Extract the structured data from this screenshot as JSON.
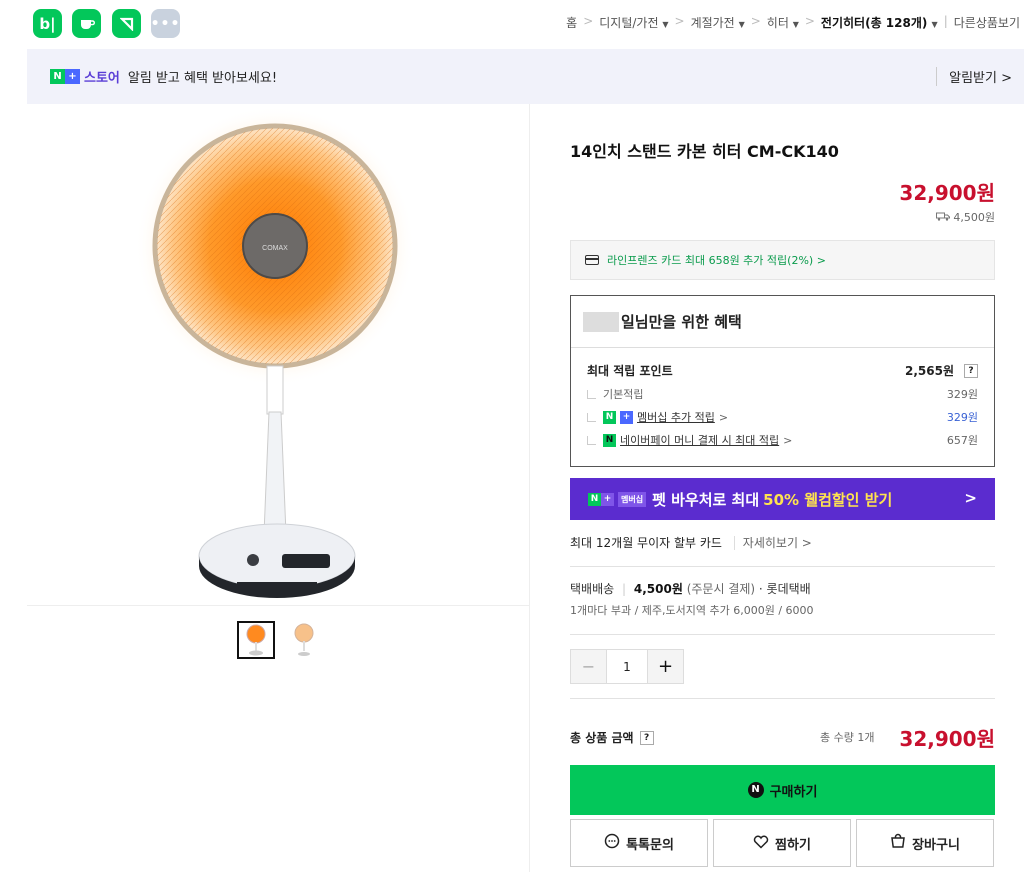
{
  "apps": [
    "blog",
    "cafe",
    "pay",
    "more"
  ],
  "breadcrumb": {
    "items": [
      "홈",
      "디지털/가전",
      "계절가전",
      "히터"
    ],
    "current": "전기히터(총 128개)",
    "other": "다른상품보기"
  },
  "banner": {
    "store_label": "스토어",
    "text": "알림 받고 혜택 받아보세요!",
    "action": "알림받기"
  },
  "product": {
    "title": "14인치 스탠드 카본 히터 CM-CK140",
    "price": "32,900원",
    "shipping_fee": "4,500원",
    "card_promo": "라인프렌즈 카드 최대 658원 추가 적립(2%) >",
    "brand_badge": "COMAX"
  },
  "benefit": {
    "header": "일님만을 위한 혜택",
    "max_label": "최대 적립 포인트",
    "max_value": "2,565원",
    "rows": [
      {
        "label": "기본적립",
        "value": "329원"
      },
      {
        "label": "멤버십 추가 적립",
        "value": "329원"
      },
      {
        "label": "네이버페이 머니 결제 시 최대 적립",
        "value": "657원"
      }
    ]
  },
  "promo": {
    "badge": "멤버십",
    "text_pre": "펫 바우처로 최대",
    "text_highlight": "50% 웰컴할인 받기",
    "chevron": ">"
  },
  "installment": {
    "text": "최대 12개월 무이자 할부 카드",
    "more": "자세히보기 >"
  },
  "delivery": {
    "method": "택배배송",
    "fee": "4,500원",
    "fee_note": "(주문시 결제)",
    "courier": "롯데택배",
    "extra": "1개마다 부과 / 제주,도서지역 추가 6,000원 / 6000"
  },
  "quantity": {
    "minus": "−",
    "value": "1",
    "plus": "+"
  },
  "total": {
    "label": "총 상품 금액",
    "help": "?",
    "qty": "총 수량 1개",
    "price": "32,900원"
  },
  "buttons": {
    "buy": "구매하기",
    "talk": "톡톡문의",
    "wish": "찜하기",
    "cart": "장바구니"
  },
  "colors": {
    "green": "#03c75a",
    "price_red": "#c8102e",
    "promo_purple": "#5b2ccf",
    "promo_yellow": "#ffe34f"
  }
}
